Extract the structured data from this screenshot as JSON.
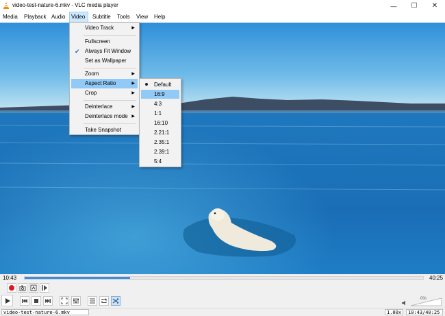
{
  "window": {
    "title": "video-test-nature-6.mkv - VLC media player",
    "minimize_glyph": "—",
    "maximize_glyph": "☐",
    "close_glyph": "✕"
  },
  "menubar": {
    "items": [
      {
        "label": "Media"
      },
      {
        "label": "Playback"
      },
      {
        "label": "Audio"
      },
      {
        "label": "Video"
      },
      {
        "label": "Subtitle"
      },
      {
        "label": "Tools"
      },
      {
        "label": "View"
      },
      {
        "label": "Help"
      }
    ],
    "active": "Video"
  },
  "video_menu": {
    "items": [
      {
        "label": "Video Track",
        "submenu": true
      },
      {
        "label": "Fullscreen"
      },
      {
        "label": "Always Fit Window",
        "checked": true
      },
      {
        "label": "Set as Wallpaper"
      },
      {
        "label": "Zoom",
        "submenu": true
      },
      {
        "label": "Aspect Ratio",
        "submenu": true,
        "highlighted": true
      },
      {
        "label": "Crop",
        "submenu": true
      },
      {
        "label": "Deinterlace",
        "submenu": true
      },
      {
        "label": "Deinterlace mode",
        "submenu": true
      },
      {
        "label": "Take Snapshot"
      }
    ]
  },
  "aspect_ratio_menu": {
    "items": [
      {
        "label": "Default",
        "selected": true
      },
      {
        "label": "16:9",
        "highlighted": true
      },
      {
        "label": "4:3"
      },
      {
        "label": "1:1"
      },
      {
        "label": "16:10"
      },
      {
        "label": "2.21:1"
      },
      {
        "label": "2.35:1"
      },
      {
        "label": "2.39:1"
      },
      {
        "label": "5:4"
      }
    ]
  },
  "player": {
    "elapsed": "10:43",
    "total": "40:25",
    "progress_fraction": 0.265,
    "volume_percent": "0%",
    "speed": "1.00x",
    "time_status": "10:43/40:25",
    "status_filename": "video-test-nature-6.mkv"
  },
  "colors": {
    "accent": "#3a8de0",
    "menu_highlight": "#91c9f7",
    "record": "#e0181e"
  },
  "icons": {
    "app": "vlc-cone-icon",
    "record": "record-icon",
    "snapshot": "camera-icon",
    "loop_ab": "loop-ab-icon",
    "frame_step": "frame-by-frame-icon",
    "play": "play-icon",
    "previous": "previous-icon",
    "stop": "stop-icon",
    "next": "next-icon",
    "fullscreen": "fullscreen-icon",
    "extended": "extended-settings-icon",
    "playlist": "playlist-icon",
    "loop": "loop-icon",
    "shuffle": "shuffle-icon",
    "mute": "speaker-icon"
  }
}
